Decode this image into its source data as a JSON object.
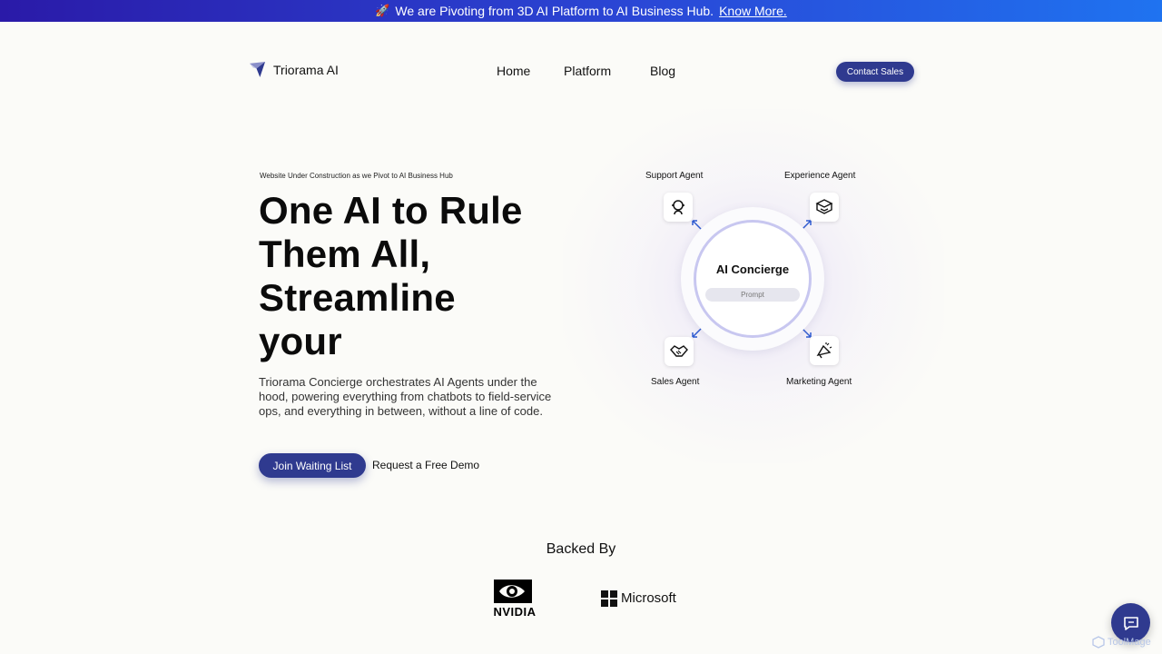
{
  "banner": {
    "rocket": "🚀",
    "text": "We are Pivoting from 3D AI Platform to AI Business Hub.",
    "link": "Know More."
  },
  "nav": {
    "logo_text": "Triorama AI",
    "links": [
      "Home",
      "Platform",
      "Blog"
    ],
    "contact_label": "Contact Sales"
  },
  "hero": {
    "kicker": "Website Under Construction as we Pivot to AI Business Hub",
    "headline_lines": [
      "One AI to Rule",
      "Them All,",
      "Streamline",
      "your"
    ],
    "description": "Triorama Concierge orchestrates AI Agents under the hood, powering everything from chatbots to field-service ops, and everything in between, without a line of code.",
    "join_label": "Join Waiting List",
    "demo_label": "Request a Free Demo"
  },
  "diagram": {
    "center_title": "AI Concierge",
    "prompt_label": "Prompt",
    "agents": {
      "support": "Support Agent",
      "experience": "Experience Agent",
      "sales": "Sales Agent",
      "marketing": "Marketing Agent"
    }
  },
  "backers": {
    "title": "Backed By",
    "nvidia": "NVIDIA",
    "microsoft": "Microsoft"
  },
  "watermark": "ToolMage",
  "colors": {
    "primary": "#2f3a8f",
    "banner_start": "#2a1aa8",
    "banner_end": "#1f73f0",
    "background": "#fbfbf8"
  }
}
